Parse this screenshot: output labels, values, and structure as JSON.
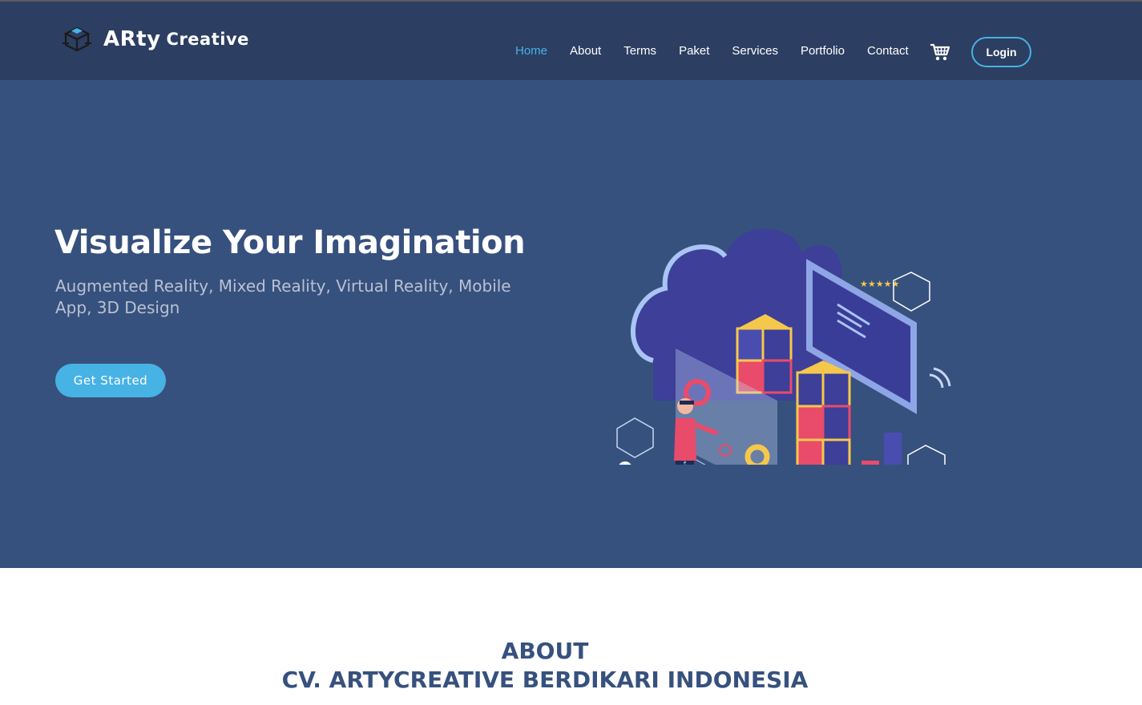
{
  "brand": {
    "name": "ARty",
    "sub": "Creative"
  },
  "nav": {
    "items": [
      {
        "label": "Home",
        "active": true
      },
      {
        "label": "About"
      },
      {
        "label": "Terms"
      },
      {
        "label": "Paket"
      },
      {
        "label": "Services"
      },
      {
        "label": "Portfolio"
      },
      {
        "label": "Contact"
      }
    ],
    "cart_icon": "cart-icon",
    "login_label": "Login"
  },
  "hero": {
    "title": "Visualize Your Imagination",
    "subtitle": "Augmented Reality, Mixed Reality, Virtual Reality, Mobile App, 3D Design",
    "cta_label": "Get Started"
  },
  "about": {
    "heading_line1": "ABOUT",
    "heading_line2": "CV. ARTYCREATIVE BERDIKARI INDONESIA"
  },
  "colors": {
    "nav_bg": "#2c3e61",
    "hero_bg": "#37517e",
    "accent": "#47b2e4",
    "heading": "#37517e"
  }
}
